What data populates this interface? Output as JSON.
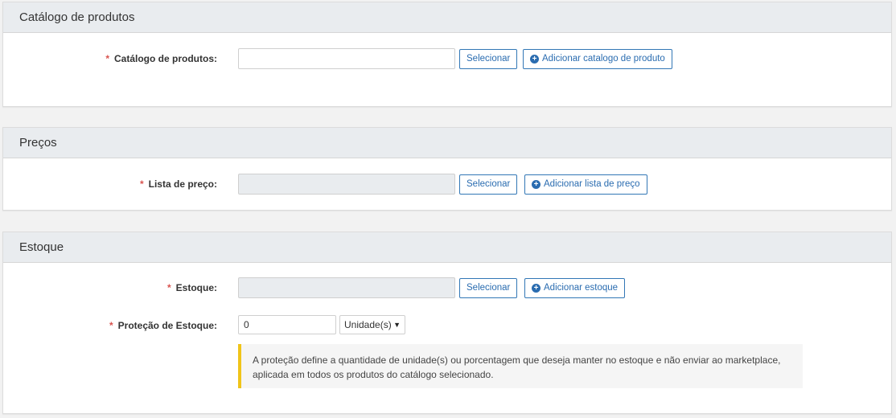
{
  "catalog": {
    "title": "Catálogo de produtos",
    "field_label": "Catálogo de produtos:",
    "input_value": "",
    "select_button": "Selecionar",
    "add_button": "Adicionar catalogo de produto"
  },
  "prices": {
    "title": "Preços",
    "field_label": "Lista de preço:",
    "select_button": "Selecionar",
    "add_button": "Adicionar lista de preço"
  },
  "stock": {
    "title": "Estoque",
    "field_label": "Estoque:",
    "select_button": "Selecionar",
    "add_button": "Adicionar estoque",
    "protection_label": "Proteção de Estoque:",
    "protection_value": "0",
    "unit_selected": "Unidade(s)",
    "notice_line1": "A proteção define a quantidade de unidade(s) ou porcentagem que deseja manter no estoque e não enviar ao marketplace,",
    "notice_line2": "aplicada em todos os produtos do catálogo selecionado."
  },
  "required_marker": "*",
  "colors": {
    "accent": "#2a6cb0",
    "required": "#d9534f",
    "notice_border": "#f0c419"
  }
}
